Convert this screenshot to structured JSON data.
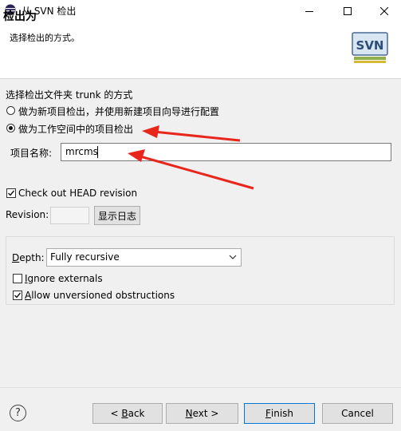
{
  "window": {
    "title": "从 SVN 检出",
    "minimize_glyph": "—",
    "maximize_glyph": "☐",
    "close_glyph": "✕"
  },
  "header": {
    "title": "检出为",
    "description": "选择检出的方式。",
    "logo_text": "SVN"
  },
  "checkout_method": {
    "label": "选择检出文件夹 trunk 的方式",
    "options": [
      {
        "label": "做为新项目检出，并使用新建项目向导进行配置",
        "selected": false
      },
      {
        "label": "做为工作空间中的项目检出",
        "selected": true
      }
    ]
  },
  "project_name": {
    "label": "项目名称:",
    "value": "mrcms"
  },
  "head_revision": {
    "checked": true,
    "label": "Check out HEAD revision"
  },
  "revision": {
    "label": "Revision:",
    "value": "",
    "show_log_label": "显示日志"
  },
  "depth": {
    "label_key": "D",
    "label_rest": "epth:",
    "selected": "Fully recursive"
  },
  "ignore_externals": {
    "checked": false,
    "label_key": "I",
    "label_rest": "gnore externals"
  },
  "allow_unversioned": {
    "checked": true,
    "label_key": "A",
    "label_rest": "llow unversioned obstructions"
  },
  "buttons": {
    "help": "?",
    "back_prefix": "< ",
    "back_key": "B",
    "back_rest": "ack",
    "next_key": "N",
    "next_rest": "ext >",
    "finish_key": "F",
    "finish_rest": "inish",
    "cancel": "Cancel"
  },
  "colors": {
    "annotation_arrow": "#e8261c",
    "focus_border": "#0078d7"
  }
}
